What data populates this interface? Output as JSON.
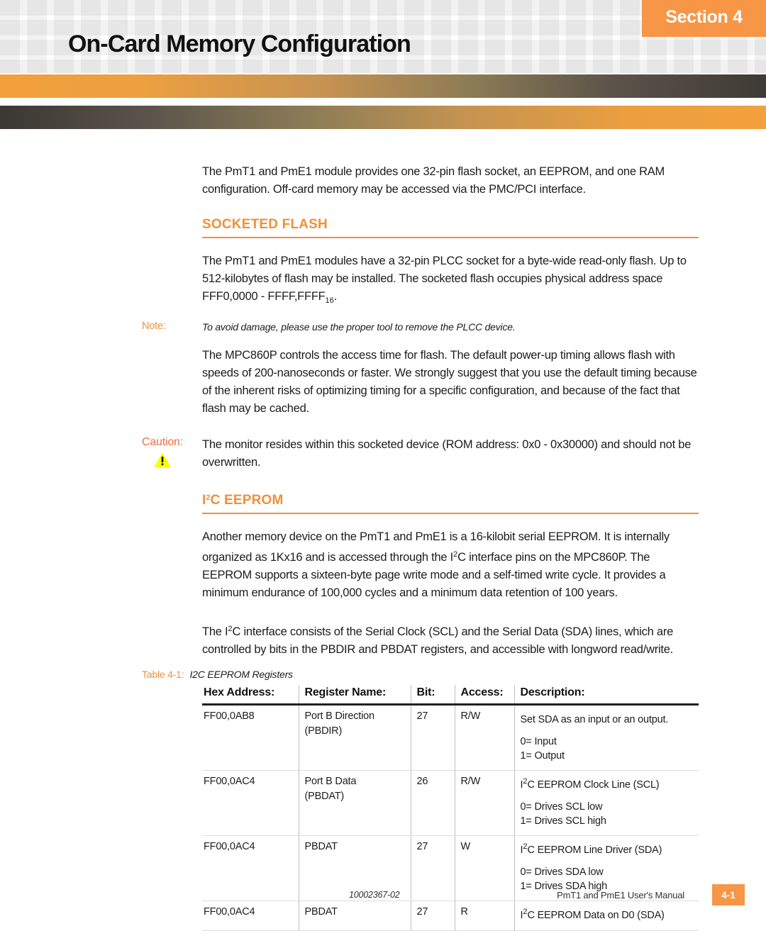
{
  "header": {
    "section_badge": "Section 4",
    "title": "On-Card Memory Configuration"
  },
  "intro": {
    "paragraph": "The PmT1 and PmE1 module provides one 32-pin flash socket, an EEPROM, and one RAM configuration. Off-card memory may be accessed via the PMC/PCI interface."
  },
  "socketed_flash": {
    "heading": "SOCKETED FLASH",
    "para1_pre": "The PmT1 and PmE1 modules have a 32-pin PLCC socket for a byte-wide read-only flash. Up to 512-kilobytes of flash may be installed. The socketed flash occupies physical address space FFF0,0000 - FFFF,FFFF",
    "para1_sub": "16",
    "para1_post": ".",
    "note_label": "Note:",
    "note_text": "To avoid damage, please use the proper tool to remove the PLCC device.",
    "para2": "The MPC860P controls the access time for flash. The default power-up timing allows flash with speeds of 200-nanoseconds or faster. We strongly suggest that you use the default timing because of the inherent risks of optimizing timing for a specific configuration, and because of the fact that flash may be cached.",
    "caution_label": "Caution:",
    "caution_icon": "warning-triangle-icon",
    "caution_text": "The monitor resides within this socketed device (ROM address: 0x0 - 0x30000) and should not be overwritten."
  },
  "i2c_eeprom": {
    "heading_pre": "I",
    "heading_sup": "2",
    "heading_post": "C EEPROM",
    "para1_a": "Another memory device on the PmT1 and PmE1 is a 16-kilobit serial EEPROM. It is internally organized as 1Kx16 and is accessed through the I",
    "para1_sup": "2",
    "para1_b": "C interface pins on the MPC860P. The EEPROM supports a sixteen-byte page write mode and a self-timed write cycle. It provides a minimum endurance of 100,000 cycles and a minimum data retention of 100 years.",
    "para2_a": "The I",
    "para2_sup": "2",
    "para2_b": "C interface consists of the Serial Clock (SCL) and the Serial Data (SDA) lines, which are controlled by bits in the PBDIR and PBDAT registers, and accessible with longword read/write."
  },
  "table": {
    "caption_number": "Table 4-1:",
    "caption_title": "I2C EEPROM Registers",
    "columns": [
      "Hex Address:",
      "Register Name:",
      "Bit:",
      "Access:",
      "Description:"
    ],
    "rows": [
      {
        "hex": "FF00,0AB8",
        "name": "Port B Direction",
        "name2": "(PBDIR)",
        "bit": "27",
        "access": "R/W",
        "desc_prefix": "",
        "desc_sup": "",
        "desc": "Set SDA as an input or an output.",
        "sub": [
          "0= Input",
          "1= Output"
        ]
      },
      {
        "hex": "FF00,0AC4",
        "name": "Port B Data",
        "name2": "(PBDAT)",
        "bit": "26",
        "access": "R/W",
        "desc_prefix": "I",
        "desc_sup": "2",
        "desc": "C  EEPROM Clock Line (SCL)",
        "sub": [
          "0= Drives SCL low",
          "1= Drives SCL high"
        ]
      },
      {
        "hex": "FF00,0AC4",
        "name": "PBDAT",
        "name2": "",
        "bit": "27",
        "access": "W",
        "desc_prefix": "I",
        "desc_sup": "2",
        "desc": "C  EEPROM Line Driver (SDA)",
        "sub": [
          "0= Drives SDA low",
          "1= Drives SDA high"
        ]
      },
      {
        "hex": "FF00,0AC4",
        "name": "PBDAT",
        "name2": "",
        "bit": "27",
        "access": "R",
        "desc_prefix": "I",
        "desc_sup": "2",
        "desc": "C  EEPROM Data on D0 (SDA)",
        "sub": []
      }
    ]
  },
  "footer": {
    "doc_number": "10002367-02",
    "manual_name": "PmT1 and PmE1 User's Manual",
    "page_number": "4-1"
  },
  "colors": {
    "accent_orange": "#f0903a",
    "badge_orange": "#f79647",
    "caution_orange": "#ef6f3c",
    "warning_yellow": "#ffff00",
    "text_dark": "#1e1c1b"
  }
}
